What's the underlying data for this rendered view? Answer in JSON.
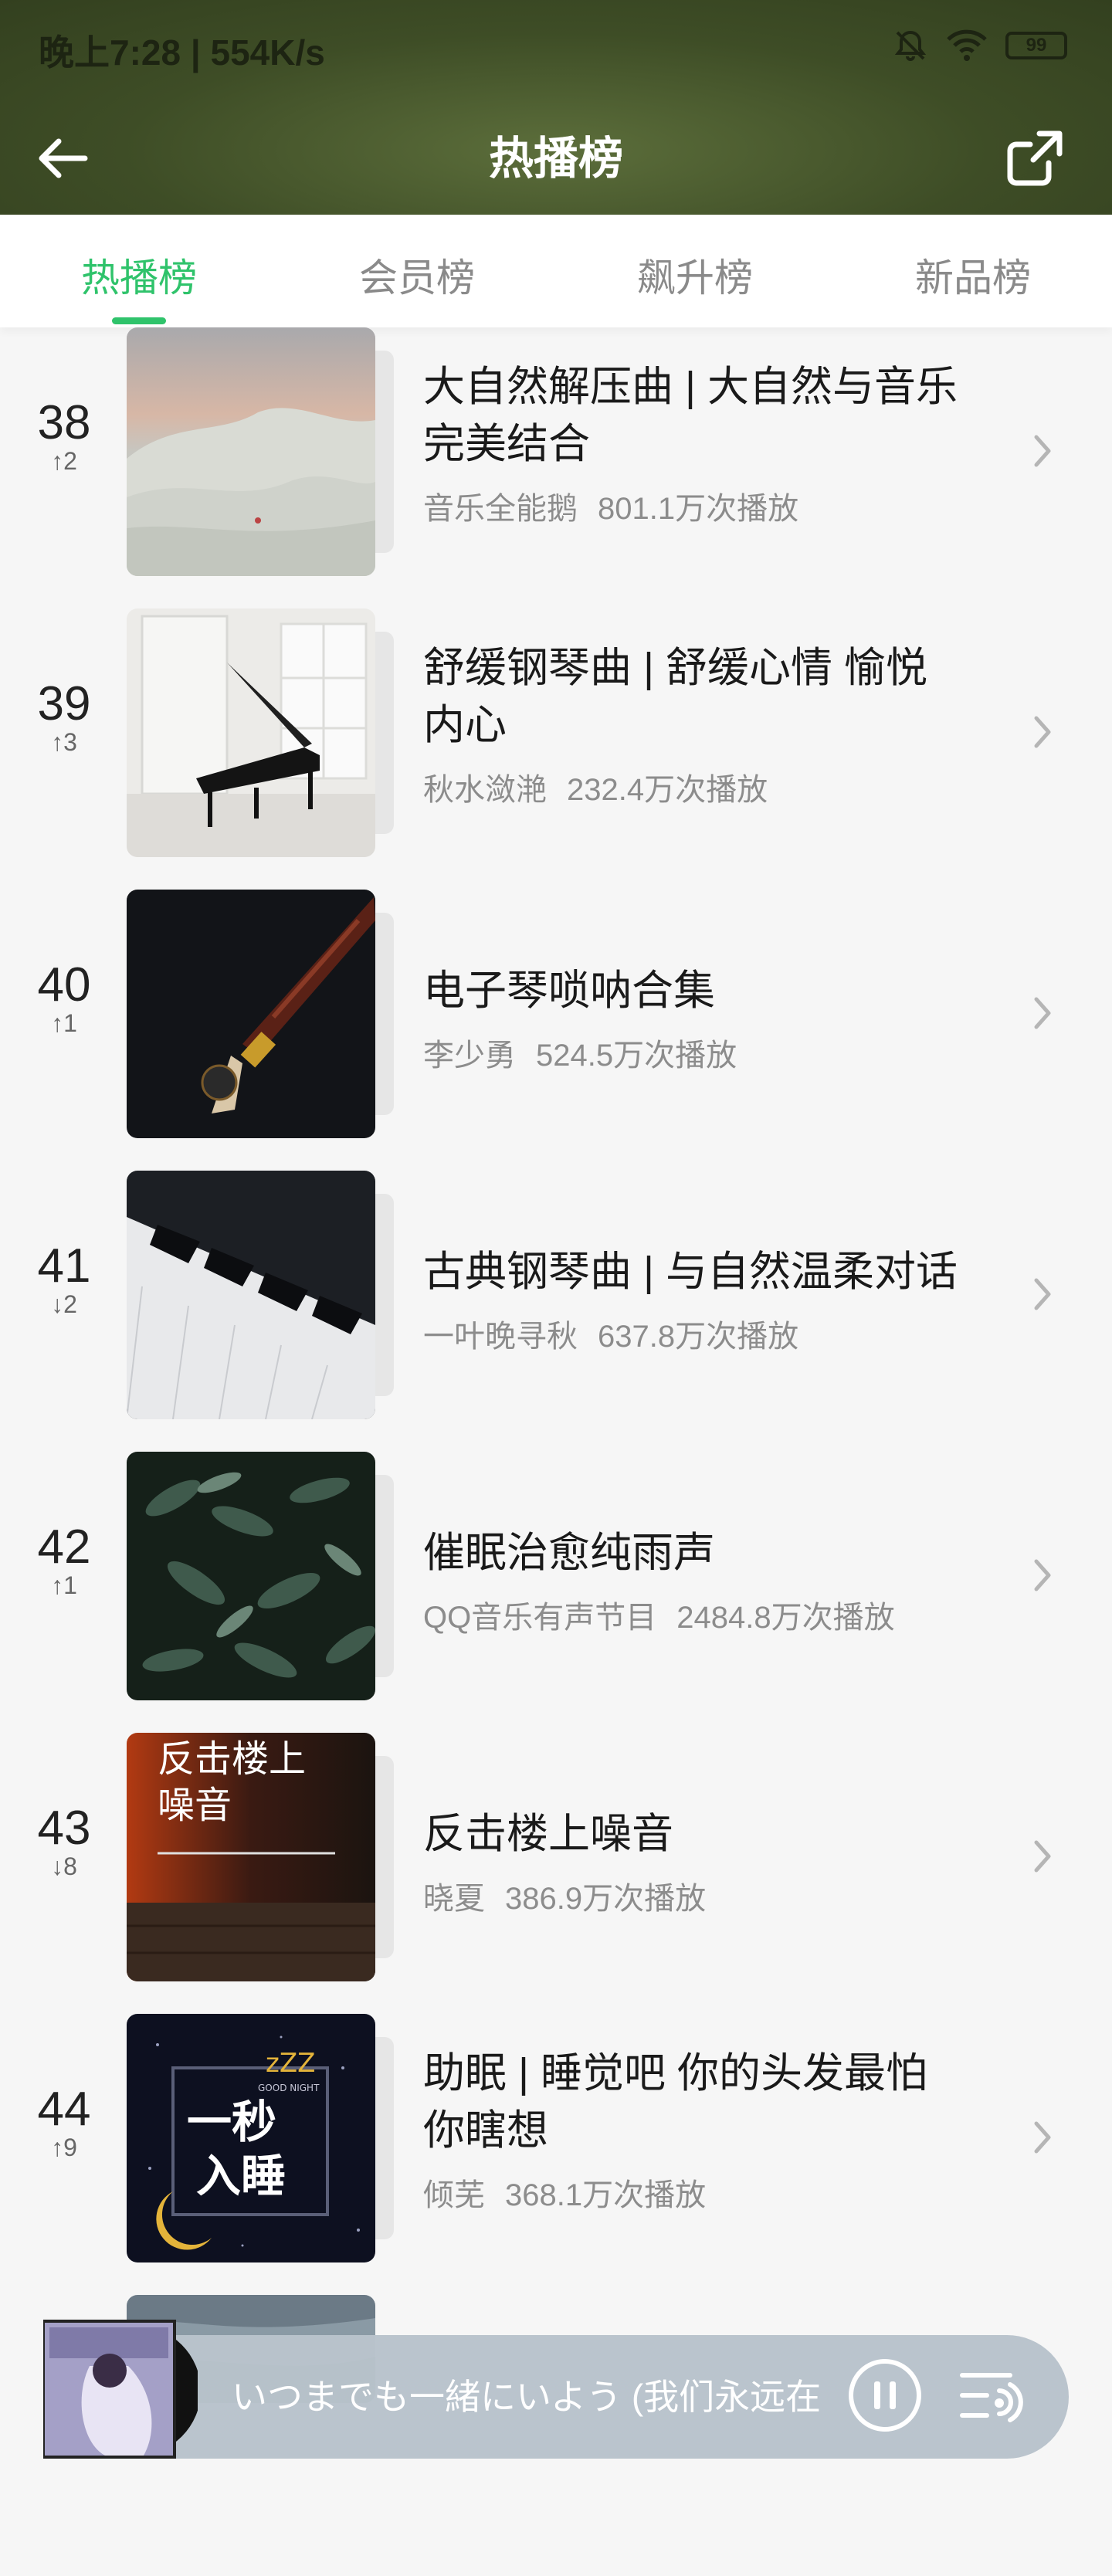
{
  "status_bar": {
    "time": "晚上7:28 | 554K/s",
    "battery": "99"
  },
  "header": {
    "title": "热播榜"
  },
  "tabs": [
    {
      "label": "热播榜",
      "active": true
    },
    {
      "label": "会员榜",
      "active": false
    },
    {
      "label": "飙升榜",
      "active": false
    },
    {
      "label": "新品榜",
      "active": false
    }
  ],
  "items": [
    {
      "rank": "38",
      "change": "↑2",
      "title": "大自然解压曲 | 大自然与音乐完美结合",
      "title_l1": "大自然解压曲 | 大自然与音乐",
      "title_l2": "完美结合",
      "author": "音乐全能鹅",
      "plays": "801.1万次播放"
    },
    {
      "rank": "39",
      "change": "↑3",
      "title_l1": "舒缓钢琴曲 | 舒缓心情 愉悦",
      "title_l2": "内心",
      "author": "秋水潋滟",
      "plays": "232.4万次播放"
    },
    {
      "rank": "40",
      "change": "↑1",
      "title": "电子琴唢呐合集",
      "author": "李少勇",
      "plays": "524.5万次播放"
    },
    {
      "rank": "41",
      "change": "↓2",
      "title": "古典钢琴曲 | 与自然温柔对话",
      "author": "一叶晚寻秋",
      "plays": "637.8万次播放"
    },
    {
      "rank": "42",
      "change": "↑1",
      "title": "催眠治愈纯雨声",
      "author": "QQ音乐有声节目",
      "plays": "2484.8万次播放"
    },
    {
      "rank": "43",
      "change": "↓8",
      "title": "反击楼上噪音",
      "author": "晓夏",
      "plays": "386.9万次播放",
      "cover_text_l1": "反击楼上",
      "cover_text_l2": "噪音"
    },
    {
      "rank": "44",
      "change": "↑9",
      "title_l1": "助眠 | 睡觉吧 你的头发最怕",
      "title_l2": "你瞎想",
      "author": "倾芜",
      "plays": "368.1万次播放",
      "cover_text_l1": "一秒",
      "cover_text_l2": "入睡",
      "cover_small": "GOOD NIGHT",
      "cover_zzz": "zZZ"
    }
  ],
  "player": {
    "now_playing": "いつまでも一緒にいよう (我们永远在"
  }
}
